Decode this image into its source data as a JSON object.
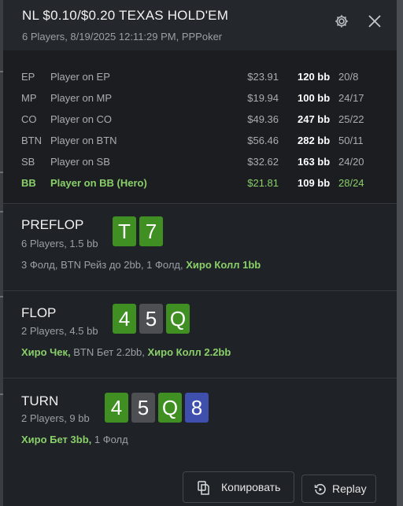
{
  "header": {
    "title": "NL $0.10/$0.20 TEXAS HOLD'EM",
    "subtitle": "6 Players, 8/19/2025 12:11:29 PM, PPPoker"
  },
  "players": [
    {
      "position": "EP",
      "name": "Player on EP",
      "amount": "$23.91",
      "bb": "120 bb",
      "vpip": "20/8",
      "hero": false
    },
    {
      "position": "MP",
      "name": "Player on MP",
      "amount": "$19.94",
      "bb": "100 bb",
      "vpip": "24/17",
      "hero": false
    },
    {
      "position": "CO",
      "name": "Player on CO",
      "amount": "$49.36",
      "bb": "247 bb",
      "vpip": "25/22",
      "hero": false
    },
    {
      "position": "BTN",
      "name": "Player on BTN",
      "amount": "$56.46",
      "bb": "282 bb",
      "vpip": "50/11",
      "hero": false
    },
    {
      "position": "SB",
      "name": "Player on SB",
      "amount": "$32.62",
      "bb": "163 bb",
      "vpip": "24/20",
      "hero": false
    },
    {
      "position": "BB",
      "name": "Player on BB (Hero)",
      "amount": "$21.81",
      "bb": "109 bb",
      "vpip": "28/24",
      "hero": true
    }
  ],
  "streets": [
    {
      "name": "PREFLOP",
      "info": "6 Players, 1.5 bb",
      "cards": [
        {
          "rank": "T",
          "suit_color": "#3f8f22"
        },
        {
          "rank": "7",
          "suit_color": "#3f8f22"
        }
      ],
      "actions": [
        {
          "text": "3 Фолд, BTN Рейз до 2bb, 1 Фолд, ",
          "hero": false
        },
        {
          "text": "Хиро Колл 1bb",
          "hero": true
        }
      ]
    },
    {
      "name": "FLOP",
      "info": "2 Players, 4.5 bb",
      "cards": [
        {
          "rank": "4",
          "suit_color": "#3f8f22"
        },
        {
          "rank": "5",
          "suit_color": "#4d4f53"
        },
        {
          "rank": "Q",
          "suit_color": "#3f8f22"
        }
      ],
      "actions": [
        {
          "text": "Хиро Чек,",
          "hero": true
        },
        {
          "text": " BTN Бет 2.2bb, ",
          "hero": false
        },
        {
          "text": "Хиро Колл 2.2bb",
          "hero": true
        }
      ]
    },
    {
      "name": "TURN",
      "info": "2 Players, 9 bb",
      "cards": [
        {
          "rank": "4",
          "suit_color": "#3f8f22"
        },
        {
          "rank": "5",
          "suit_color": "#4d4f53"
        },
        {
          "rank": "Q",
          "suit_color": "#3f8f22"
        },
        {
          "rank": "8",
          "suit_color": "#3e4fae"
        }
      ],
      "actions": [
        {
          "text": "Хиро Бет 3bb,",
          "hero": true
        },
        {
          "text": " 1 Фолд",
          "hero": false
        }
      ]
    }
  ],
  "footer": {
    "copy_label": "Копировать",
    "replay_label": "Replay"
  },
  "icons": {
    "settings": "gear-icon",
    "close": "close-icon",
    "copy": "copy-icon",
    "replay": "replay-icon"
  },
  "colors": {
    "hero_green": "#8ad06a",
    "card_green": "#3f8f22",
    "card_gray": "#4d4f53",
    "card_blue": "#3e4fae"
  }
}
